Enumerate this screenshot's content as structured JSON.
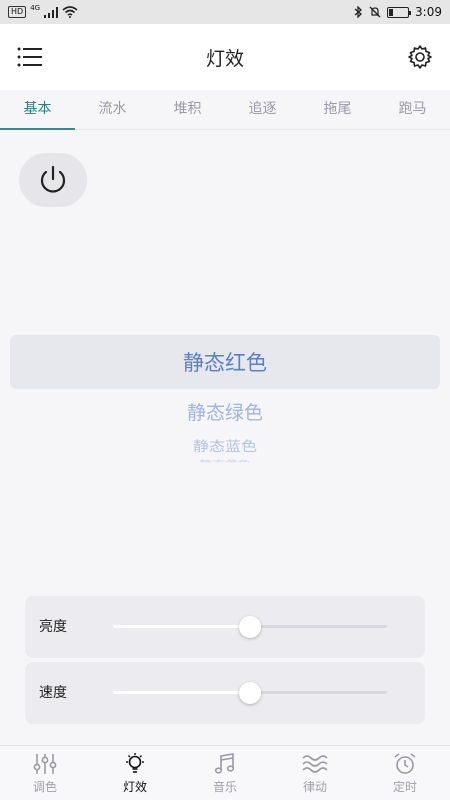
{
  "status_bar": {
    "left_chip": "HD",
    "network": "4G",
    "time": "3:09",
    "battery_level": 0.2
  },
  "header": {
    "title": "灯效"
  },
  "tabs": [
    {
      "label": "基本",
      "active": true
    },
    {
      "label": "流水",
      "active": false
    },
    {
      "label": "堆积",
      "active": false
    },
    {
      "label": "追逐",
      "active": false
    },
    {
      "label": "拖尾",
      "active": false
    },
    {
      "label": "跑马",
      "active": false
    }
  ],
  "picker": {
    "items": [
      "静态红色",
      "静态绿色",
      "静态蓝色",
      "静态黄色"
    ],
    "selected_index": 0
  },
  "sliders": [
    {
      "label": "亮度",
      "value": 0.5
    },
    {
      "label": "速度",
      "value": 0.5
    }
  ],
  "bottom_nav": [
    {
      "label": "调色",
      "icon": "sliders-icon",
      "active": false
    },
    {
      "label": "灯效",
      "icon": "bulb-icon",
      "active": true
    },
    {
      "label": "音乐",
      "icon": "music-note-icon",
      "active": false
    },
    {
      "label": "律动",
      "icon": "wave-icon",
      "active": false
    },
    {
      "label": "定时",
      "icon": "alarm-clock-icon",
      "active": false
    }
  ],
  "colors": {
    "accent_tab": "#2f7d7a",
    "picker_text": "#5a7ec8",
    "background": "#f6f6f9"
  }
}
